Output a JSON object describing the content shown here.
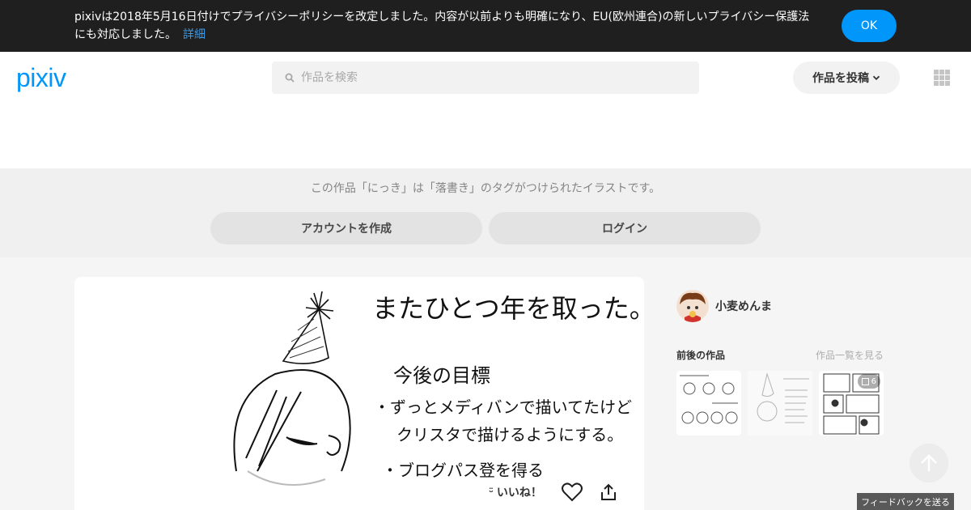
{
  "banner": {
    "message": "pixivは2018年5月16日付けでプライバシーポリシーを改定しました。内容が以前よりも明確になり、EU(欧州連合)の新しいプライバシー保護法にも対応しました。",
    "details_link": "詳細",
    "ok_button": "OK"
  },
  "header": {
    "logo": "pixiv",
    "search_placeholder": "作品を検索",
    "post_button": "作品を投稿"
  },
  "tagband": {
    "description": "この作品「にっき」は「落書き」のタグがつけられたイラストです。",
    "create_account": "アカウントを作成",
    "login": "ログイン"
  },
  "artwork": {
    "lines": [
      "またひとつ年を取った。",
      "今後の目標",
      "・ずっとメディバンで描いてたけど",
      "クリスタで描けるようにする。",
      "・ブログパス登を得る"
    ],
    "like_label": "いいね！"
  },
  "sidebar": {
    "author_name": "小麦めんま",
    "works_title": "前後の作品",
    "works_link": "作品一覧を見る",
    "thumb3_pages": "6"
  },
  "feedback": "フィードバックを送る",
  "colors": {
    "brand": "#0096fa",
    "banner_bg": "#1f1f1f"
  }
}
